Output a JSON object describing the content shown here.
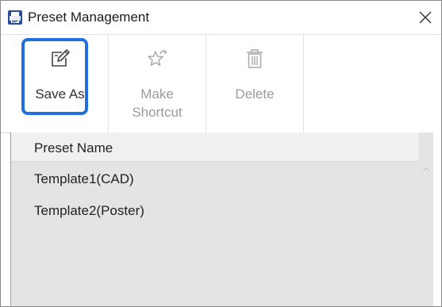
{
  "window": {
    "title": "Preset Management"
  },
  "toolbar": {
    "buttons": [
      {
        "label": "Save As",
        "icon": "edit-note-icon",
        "enabled": true
      },
      {
        "label": "Make\nShortcut",
        "icon": "star-shortcut-icon",
        "enabled": false
      },
      {
        "label": "Delete",
        "icon": "trash-icon",
        "enabled": false
      }
    ]
  },
  "list": {
    "header": "Preset Name",
    "rows": [
      {
        "name": "Template1(CAD)"
      },
      {
        "name": "Template2(Poster)"
      }
    ]
  },
  "colors": {
    "focus_ring": "#1f6fe0",
    "disabled_text": "#9b9b9b",
    "list_background": "#e4e4e4"
  }
}
